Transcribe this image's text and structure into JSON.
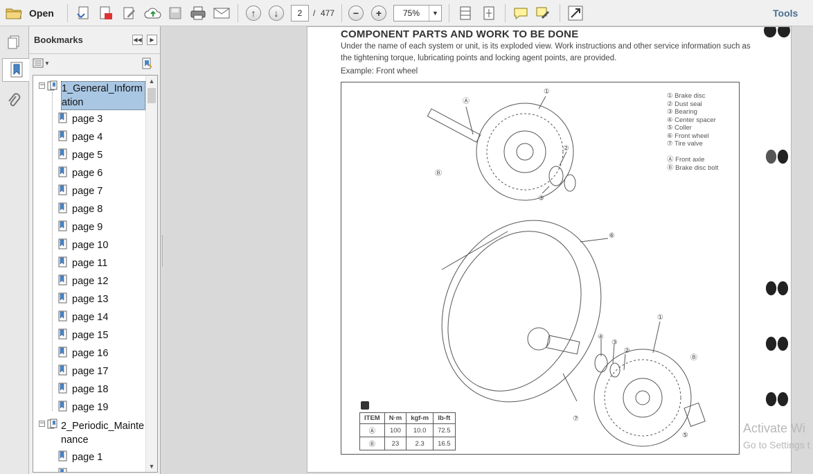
{
  "toolbar": {
    "open_label": "Open",
    "current_page": "2",
    "page_separator": "/",
    "total_pages": "477",
    "zoom": "75%",
    "tools_label": "Tools"
  },
  "bookmarks_panel": {
    "title": "Bookmarks",
    "items": [
      {
        "label": "1_General_Information",
        "line1": "1_General_Inform",
        "line2": "ation",
        "level": 0,
        "selected": true
      },
      {
        "label": "page 3",
        "level": 1
      },
      {
        "label": "page 4",
        "level": 1
      },
      {
        "label": "page 5",
        "level": 1
      },
      {
        "label": "page 6",
        "level": 1
      },
      {
        "label": "page 7",
        "level": 1
      },
      {
        "label": "page 8",
        "level": 1
      },
      {
        "label": "page 9",
        "level": 1
      },
      {
        "label": "page 10",
        "level": 1
      },
      {
        "label": "page 11",
        "level": 1
      },
      {
        "label": "page 12",
        "level": 1
      },
      {
        "label": "page 13",
        "level": 1
      },
      {
        "label": "page 14",
        "level": 1
      },
      {
        "label": "page 15",
        "level": 1
      },
      {
        "label": "page 16",
        "level": 1
      },
      {
        "label": "page 17",
        "level": 1
      },
      {
        "label": "page 18",
        "level": 1
      },
      {
        "label": "page 19",
        "level": 1
      },
      {
        "label": "2_Periodic_Maintenance",
        "line1": "2_Periodic_Mainte",
        "line2": "nance",
        "level": 0
      },
      {
        "label": "page 1",
        "level": 1
      }
    ]
  },
  "document": {
    "heading": "COMPONENT PARTS AND WORK TO BE DONE",
    "intro": "Under the name of each system or unit, is its exploded view. Work instructions and other service information such as the tightening torque, lubricating points and locking agent points, are provided.",
    "example": "Example: Front wheel",
    "legend_parts": [
      "① Brake disc",
      "② Dust seal",
      "③ Bearing",
      "④ Center spacer",
      "⑤ Coller",
      "⑥ Front wheel",
      "⑦ Tire valve"
    ],
    "legend_fasteners": [
      "Ⓐ Front axle",
      "Ⓑ Brake disc bolt"
    ],
    "torque_table": {
      "headers": [
        "ITEM",
        "N·m",
        "kgf-m",
        "lb-ft"
      ],
      "rows": [
        [
          "Ⓐ",
          "100",
          "10.0",
          "72.5"
        ],
        [
          "Ⓑ",
          "23",
          "2.3",
          "16.5"
        ]
      ]
    },
    "callouts": {
      "c1": "①",
      "c2": "②",
      "c3": "③",
      "c4": "④",
      "c5": "⑤",
      "c6": "⑥",
      "c7": "⑦",
      "cA": "Ⓐ",
      "cB": "Ⓑ"
    }
  },
  "watermark": {
    "line1": "Activate Wi",
    "line2": "Go to Settings t"
  }
}
